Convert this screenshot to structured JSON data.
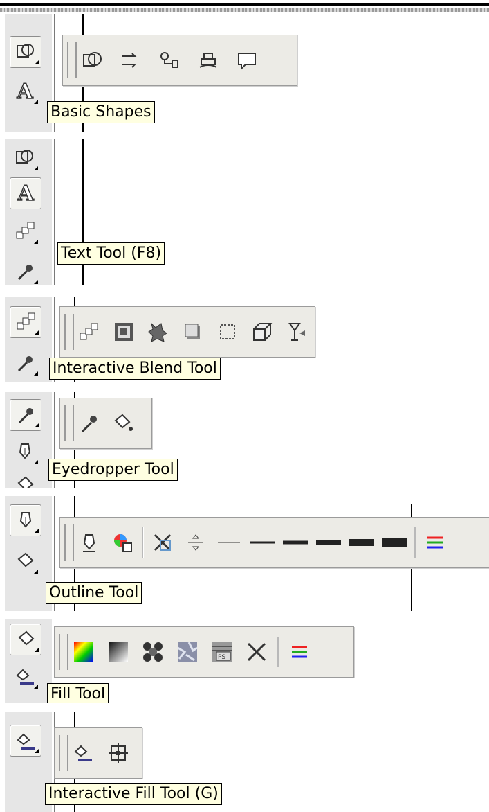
{
  "tooltips": {
    "basic_shapes": "Basic Shapes",
    "text_tool": "Text Tool (F8)",
    "interactive_blend": "Interactive Blend Tool",
    "eyedropper": "Eyedropper Tool",
    "outline": "Outline Tool",
    "fill": "Fill Tool",
    "interactive_fill": "Interactive Fill Tool (G)"
  },
  "flyouts": {
    "basic_shapes": [
      "basic-shapes-icon",
      "arrow-shapes-icon",
      "flowchart-shapes-icon",
      "banner-shapes-icon",
      "callout-shapes-icon"
    ],
    "interactive": [
      "blend-icon",
      "contour-icon",
      "distortion-icon",
      "drop-shadow-icon",
      "envelope-icon",
      "extrude-icon",
      "transparency-icon"
    ],
    "eyedropper": [
      "eyedropper-icon",
      "paintbucket-icon"
    ],
    "outline": [
      "outline-pen-icon",
      "outline-color-icon",
      "no-outline-icon",
      "hairline-icon",
      "thin-line-icon",
      "line-1-icon",
      "line-2-icon",
      "line-3-icon",
      "line-4-icon",
      "line-5-icon",
      "color-docker-icon"
    ],
    "fill": [
      "fountain-color-icon",
      "fountain-fill-icon",
      "pattern-fill-icon",
      "texture-fill-icon",
      "postscript-fill-icon",
      "no-fill-icon",
      "color-docker-icon"
    ],
    "interactive_fill": [
      "interactive-fill-icon",
      "mesh-fill-icon"
    ]
  },
  "colors": {
    "toolbox": "#e6e6e6",
    "flyout": "#ecebe6",
    "tooltip": "#ffffe1"
  }
}
